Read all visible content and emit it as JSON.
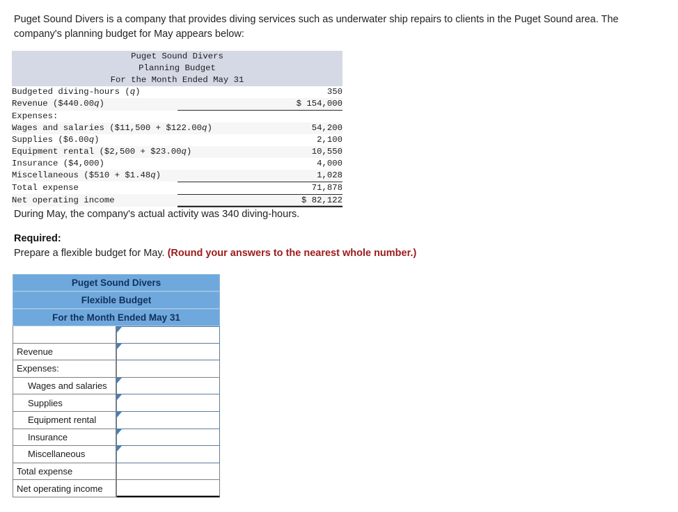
{
  "intro": {
    "paragraph": "Puget Sound Divers is a company that provides diving services such as underwater ship repairs to clients in the Puget Sound area. The company's planning budget for May appears below:"
  },
  "planning_budget": {
    "title_line1": "Puget Sound Divers",
    "title_line2": "Planning Budget",
    "title_line3": "For the Month Ended May 31",
    "rows": [
      {
        "label": "Budgeted diving-hours (",
        "label_italic": "q",
        "label_tail": ")",
        "value": "350",
        "indent": 0,
        "rule": "none"
      },
      {
        "label": "Revenue ($440.00",
        "label_italic": "q",
        "label_tail": ")",
        "value": "$ 154,000",
        "indent": 0,
        "rule": "single"
      },
      {
        "label": "Expenses:",
        "label_italic": "",
        "label_tail": "",
        "value": "",
        "indent": 0,
        "rule": "none"
      },
      {
        "label": "Wages and salaries ($11,500 + $122.00",
        "label_italic": "q",
        "label_tail": ")",
        "value": "54,200",
        "indent": 1,
        "rule": "none"
      },
      {
        "label": "Supplies ($6.00",
        "label_italic": "q",
        "label_tail": ")",
        "value": "2,100",
        "indent": 1,
        "rule": "none"
      },
      {
        "label": "Equipment rental ($2,500 + $23.00",
        "label_italic": "q",
        "label_tail": ")",
        "value": "10,550",
        "indent": 1,
        "rule": "none"
      },
      {
        "label": "Insurance ($4,000)",
        "label_italic": "",
        "label_tail": "",
        "value": "4,000",
        "indent": 1,
        "rule": "none"
      },
      {
        "label": "Miscellaneous ($510 + $1.48",
        "label_italic": "q",
        "label_tail": ")",
        "value": "1,028",
        "indent": 1,
        "rule": "single"
      },
      {
        "label": "Total expense",
        "label_italic": "",
        "label_tail": "",
        "value": "71,878",
        "indent": 0,
        "rule": "single"
      },
      {
        "label": "Net operating income",
        "label_italic": "",
        "label_tail": "",
        "value": "$ 82,122",
        "indent": 0,
        "rule": "double"
      }
    ]
  },
  "actual_activity": {
    "text": "During May, the company's actual activity was 340 diving-hours."
  },
  "required": {
    "label": "Required:",
    "instruction": "Prepare a flexible budget for May. ",
    "round_note": "(Round your answers to the nearest whole number.)"
  },
  "flexible_budget": {
    "title_line1": "Puget Sound Divers",
    "title_line2": "Flexible Budget",
    "title_line3": "For the Month Ended May 31",
    "header_bg": "#6fa8dc",
    "header_text_color": "#12305c",
    "rows": [
      {
        "label": "",
        "value": "",
        "indent": false,
        "flag": true,
        "input_style": "outlined",
        "first": true
      },
      {
        "label": "Revenue",
        "value": "",
        "indent": false,
        "flag": true,
        "input_style": "outlined",
        "first": false
      },
      {
        "label": "Expenses:",
        "value": "",
        "indent": false,
        "flag": false,
        "input_style": "plain",
        "first": false
      },
      {
        "label": "Wages and salaries",
        "value": "",
        "indent": true,
        "flag": true,
        "input_style": "outlined",
        "first": false
      },
      {
        "label": "Supplies",
        "value": "",
        "indent": true,
        "flag": true,
        "input_style": "outlined",
        "first": false
      },
      {
        "label": "Equipment rental",
        "value": "",
        "indent": true,
        "flag": true,
        "input_style": "outlined",
        "first": false
      },
      {
        "label": "Insurance",
        "value": "",
        "indent": true,
        "flag": true,
        "input_style": "outlined",
        "first": false
      },
      {
        "label": "Miscellaneous",
        "value": "",
        "indent": true,
        "flag": true,
        "input_style": "outlined",
        "first": false
      },
      {
        "label": "Total expense",
        "value": "",
        "indent": false,
        "flag": false,
        "input_style": "plain",
        "first": false
      },
      {
        "label": "Net operating income",
        "value": "",
        "indent": false,
        "flag": false,
        "input_style": "plain-double",
        "first": false
      }
    ]
  }
}
